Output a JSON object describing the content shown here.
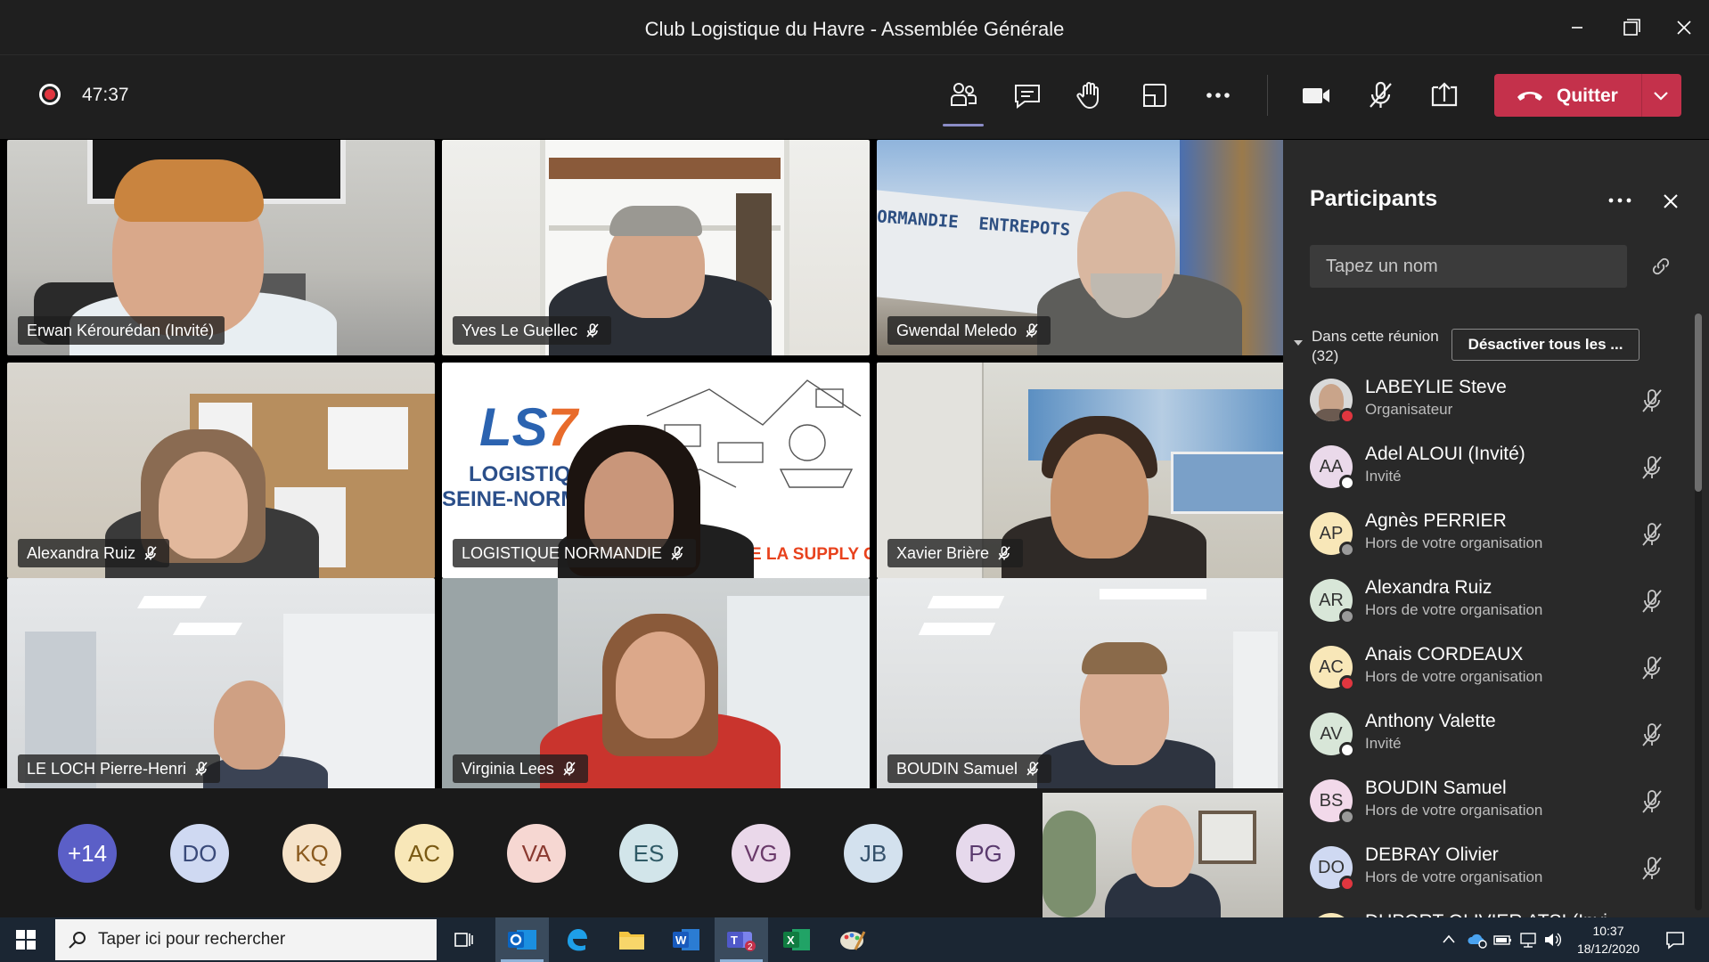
{
  "window": {
    "title": "Club Logistique du Havre - Assemblée Générale"
  },
  "meeting": {
    "timer": "47:37",
    "quit_label": "Quitter"
  },
  "tiles": [
    {
      "name": "Erwan Kérourédan (Invité)",
      "muted": false
    },
    {
      "name": "Yves Le Guellec",
      "muted": true
    },
    {
      "name": "Gwendal Meledo",
      "muted": true
    },
    {
      "name": "Alexandra Ruiz",
      "muted": true
    },
    {
      "name": "LOGISTIQUE NORMANDIE",
      "muted": true
    },
    {
      "name": "Xavier Brière",
      "muted": true
    },
    {
      "name": "LE LOCH Pierre-Henri",
      "muted": true
    },
    {
      "name": "Virginia Lees",
      "muted": true
    },
    {
      "name": "BOUDIN Samuel",
      "muted": true
    }
  ],
  "tile_scene_text": {
    "warehouse_sign": "ORMANDIE  ENTREPOTS",
    "logo_line1": "LOGISTIQUE",
    "logo_line2": "SEINE-NORMAN",
    "banner": "ELS DE LA SUPPLY CHAI"
  },
  "strip": {
    "avatars": [
      {
        "initials": "+14",
        "bg": "#5b5fc7",
        "fg": "#ffffff"
      },
      {
        "initials": "DO",
        "bg": "#cfd9f2",
        "fg": "#3a4a7a"
      },
      {
        "initials": "KQ",
        "bg": "#f6e3c9",
        "fg": "#8a5a1f"
      },
      {
        "initials": "AC",
        "bg": "#f8e7b8",
        "fg": "#7a5a14"
      },
      {
        "initials": "VA",
        "bg": "#f6d7d2",
        "fg": "#8a3a30"
      },
      {
        "initials": "ES",
        "bg": "#d2e5ea",
        "fg": "#2f5a66"
      },
      {
        "initials": "VG",
        "bg": "#ead8ea",
        "fg": "#6a3a6a"
      },
      {
        "initials": "JB",
        "bg": "#d3e1ee",
        "fg": "#34506a"
      },
      {
        "initials": "PG",
        "bg": "#e6d9ec",
        "fg": "#5a3a6e"
      }
    ]
  },
  "panel": {
    "title": "Participants",
    "search_placeholder": "Tapez un nom",
    "section_label": "Dans cette réunion",
    "section_count": "(32)",
    "mute_all_label": "Désactiver tous les ...",
    "participants": [
      {
        "initials": "",
        "name": "LABEYLIE Steve",
        "role": "Organisateur",
        "bg": "#d9d9d9",
        "status": "#e0363f",
        "photo": true
      },
      {
        "initials": "AA",
        "name": "Adel ALOUI (Invité)",
        "role": "Invité",
        "bg": "#ead9ea",
        "status": "#ffffff"
      },
      {
        "initials": "AP",
        "name": "Agnès PERRIER",
        "role": "Hors de votre organisation",
        "bg": "#f8e7b8",
        "status": "#9a9a9a"
      },
      {
        "initials": "AR",
        "name": "Alexandra Ruiz",
        "role": "Hors de votre organisation",
        "bg": "#d8e6d8",
        "status": "#9a9a9a"
      },
      {
        "initials": "AC",
        "name": "Anais CORDEAUX",
        "role": "Hors de votre organisation",
        "bg": "#f8e7b8",
        "status": "#e0363f"
      },
      {
        "initials": "AV",
        "name": "Anthony Valette",
        "role": "Invité",
        "bg": "#d8e6d8",
        "status": "#ffffff"
      },
      {
        "initials": "BS",
        "name": "BOUDIN Samuel",
        "role": "Hors de votre organisation",
        "bg": "#f2d9ea",
        "status": "#9a9a9a"
      },
      {
        "initials": "DO",
        "name": "DEBRAY Olivier",
        "role": "Hors de votre organisation",
        "bg": "#cfd9f2",
        "status": "#e0363f"
      },
      {
        "initials": "",
        "name": "DUPORT OLIVIER ATSI (Invi...",
        "role": "",
        "bg": "#f8e7b8",
        "status": "#9a9a9a"
      }
    ]
  },
  "taskbar": {
    "search_placeholder": "Taper ici pour rechercher",
    "time": "10:37",
    "date": "18/12/2020"
  }
}
